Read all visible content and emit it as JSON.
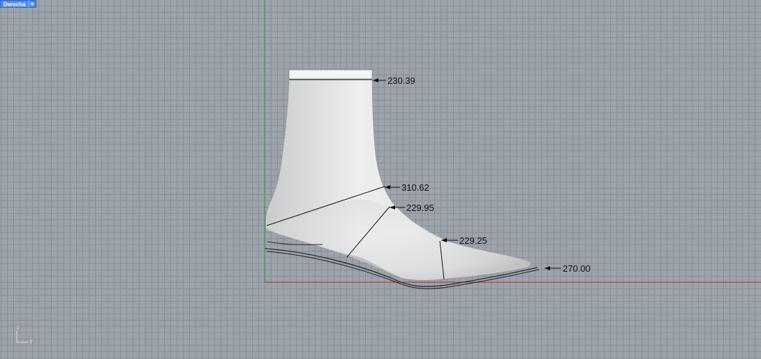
{
  "viewport": {
    "name": "Derecha",
    "menu_icon": "chevron-down-icon"
  },
  "dimensions": [
    {
      "id": "top",
      "value": "230.39"
    },
    {
      "id": "instep",
      "value": "310.62"
    },
    {
      "id": "waist",
      "value": "229.95"
    },
    {
      "id": "ball",
      "value": "229.25"
    },
    {
      "id": "sole",
      "value": "270.00"
    }
  ],
  "axis_widget": {
    "z_label": "z",
    "y_label": "y"
  },
  "colors": {
    "tab_bg": "#4f8df0",
    "x_axis": "#c03030",
    "z_axis": "#2f9a2f",
    "grid": "#878e96",
    "background": "#9ca3aa"
  }
}
